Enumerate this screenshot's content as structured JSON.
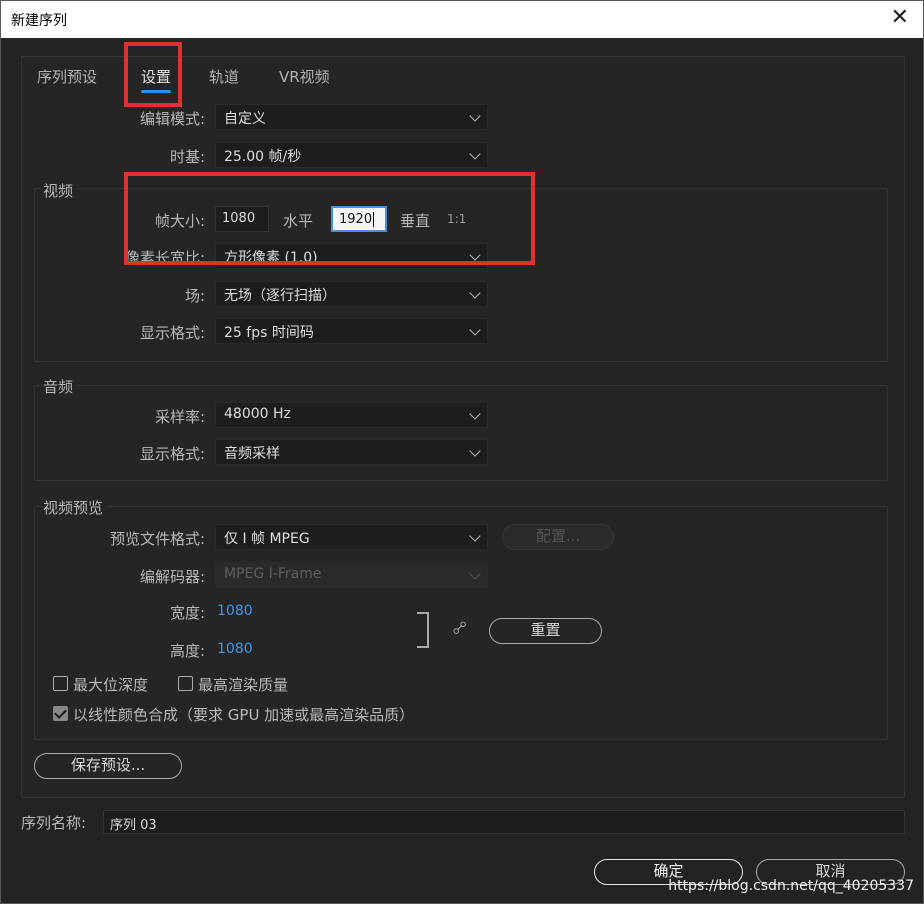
{
  "window": {
    "title": "新建序列",
    "close_glyph": "✕"
  },
  "tabs": [
    {
      "label": "序列预设",
      "active": false
    },
    {
      "label": "设置",
      "active": true
    },
    {
      "label": "轨道",
      "active": false
    },
    {
      "label": "VR视频",
      "active": false
    }
  ],
  "settings": {
    "edit_mode": {
      "label": "编辑模式:",
      "value": "自定义"
    },
    "timebase": {
      "label": "时基:",
      "value": "25.00  帧/秒"
    }
  },
  "video": {
    "section_title": "视频",
    "frame_size": {
      "label": "帧大小:",
      "horizontal_value": "1080",
      "horizontal_label": "水平",
      "vertical_value": "1920",
      "vertical_label": "垂直",
      "ratio": "1:1"
    },
    "pixel_aspect": {
      "label": "像素长宽比:",
      "value": "方形像素 (1.0)"
    },
    "field": {
      "label": "场:",
      "value": "无场（逐行扫描）"
    },
    "display_format": {
      "label": "显示格式:",
      "value": "25 fps 时间码"
    }
  },
  "audio": {
    "section_title": "音频",
    "sample_rate": {
      "label": "采样率:",
      "value": "48000 Hz"
    },
    "display_format": {
      "label": "显示格式:",
      "value": "音频采样"
    }
  },
  "video_preview": {
    "section_title": "视频预览",
    "file_format": {
      "label": "预览文件格式:",
      "value": "仅 I 帧 MPEG"
    },
    "configure_button": "配置...",
    "codec": {
      "label": "编解码器:",
      "value": "MPEG I-Frame"
    },
    "width": {
      "label": "宽度:",
      "value": "1080"
    },
    "height": {
      "label": "高度:",
      "value": "1080"
    },
    "reset_button": "重置",
    "link_icon": "chain-link"
  },
  "options": {
    "max_bit_depth": {
      "label": "最大位深度",
      "checked": false
    },
    "max_render_quality": {
      "label": "最高渲染质量",
      "checked": false
    },
    "linear_color": {
      "label": "以线性颜色合成（要求 GPU 加速或最高渲染品质）",
      "checked": true
    }
  },
  "save_preset_button": "保存预设...",
  "sequence_name": {
    "label": "序列名称:",
    "value": "序列 03"
  },
  "footer": {
    "ok_button": "确定",
    "cancel_button": "取消"
  },
  "watermark": "https://blog.csdn.net/qq_40205337"
}
